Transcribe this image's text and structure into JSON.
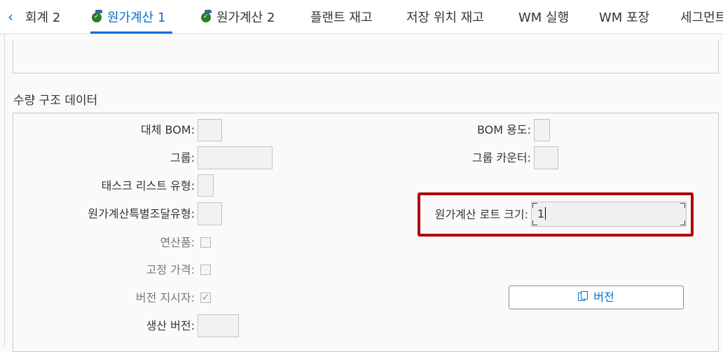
{
  "tabs": [
    {
      "label": "회계 2",
      "active": false,
      "has_icon": false
    },
    {
      "label": "원가계산 1",
      "active": true,
      "has_icon": true
    },
    {
      "label": "원가계산 2",
      "active": false,
      "has_icon": true
    },
    {
      "label": "플랜트 재고",
      "active": false,
      "has_icon": false
    },
    {
      "label": "저장 위치 재고",
      "active": false,
      "has_icon": false
    },
    {
      "label": "WM 실행",
      "active": false,
      "has_icon": false
    },
    {
      "label": "WM 포장",
      "active": false,
      "has_icon": false
    },
    {
      "label": "세그먼트",
      "active": false,
      "has_icon": false
    }
  ],
  "section": {
    "title": "수량 구조 데이터",
    "alt_bom_label": "대체 BOM:",
    "alt_bom_value": "",
    "group_label": "그룹:",
    "group_value": "",
    "task_list_type_label": "태스크 리스트 유형:",
    "task_list_type_value": "",
    "special_procurement_label": "원가계산특별조달유형:",
    "special_procurement_value": "",
    "coproduct_label": "연산품:",
    "coproduct_checked": false,
    "fixed_price_label": "고정 가격:",
    "fixed_price_checked": false,
    "version_indicator_label": "버전 지시자:",
    "version_indicator_checked": true,
    "production_version_label": "생산 버전:",
    "production_version_value": "",
    "bom_usage_label": "BOM 용도:",
    "bom_usage_value": "",
    "group_counter_label": "그룹 카운터:",
    "group_counter_value": "",
    "costing_lot_size_label": "원가계산 로트 크기:",
    "costing_lot_size_value": "1",
    "versions_button_label": "버전"
  },
  "colors": {
    "accent": "#0a6ed1",
    "highlight_border": "#b00000"
  },
  "icons": {
    "back": "chevron-left-icon",
    "costing_tab": "costing-check-icon",
    "versions_button": "copy-icon"
  }
}
